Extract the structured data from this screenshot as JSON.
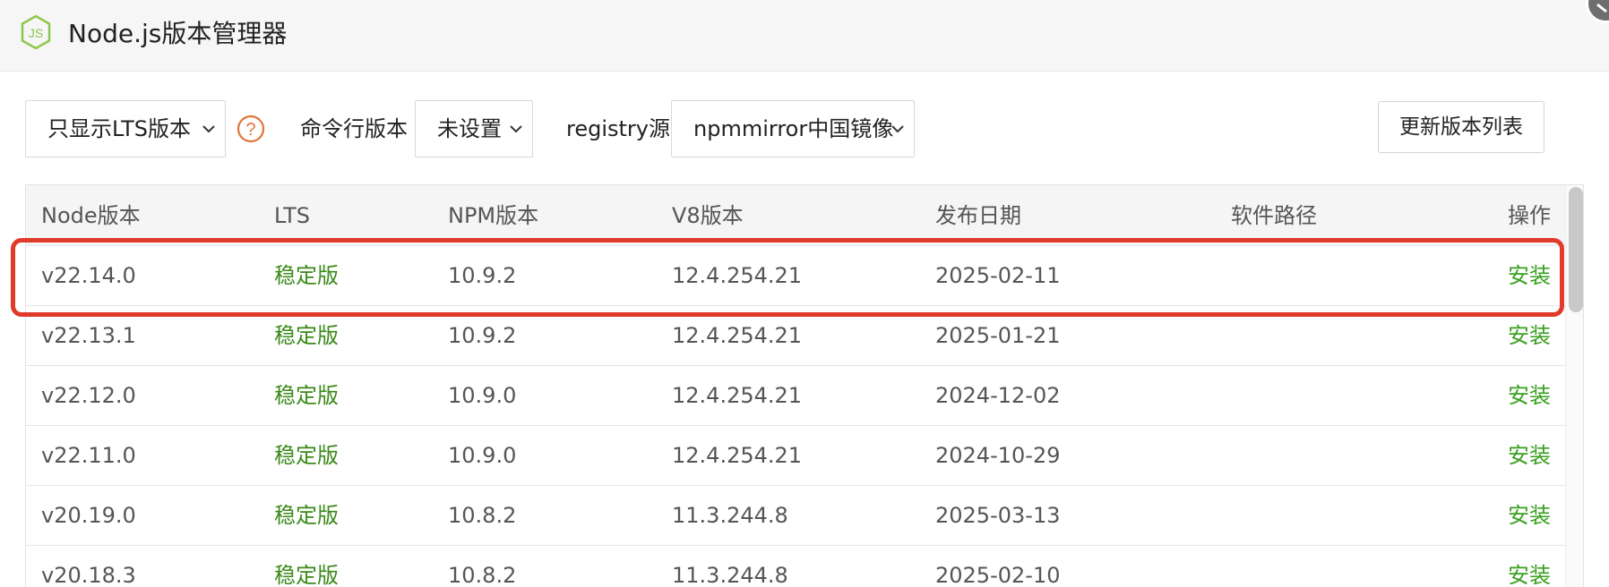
{
  "window": {
    "title": "Node.js版本管理器",
    "logo_icon": "nodejs-hexagon-icon",
    "close_icon": "close-icon"
  },
  "toolbar": {
    "filter_select": {
      "value": "只显示LTS版本"
    },
    "help_icon": "question-circle-icon",
    "cli_label": "命令行版本",
    "cli_select": {
      "value": "未设置"
    },
    "registry_label": "registry源",
    "registry_select": {
      "value": "npmmirror中国镜像"
    },
    "refresh_label": "更新版本列表"
  },
  "table": {
    "columns": [
      "Node版本",
      "LTS",
      "NPM版本",
      "V8版本",
      "发布日期",
      "软件路径",
      "操作"
    ],
    "rows": [
      {
        "node": "v22.14.0",
        "lts": "稳定版",
        "npm": "10.9.2",
        "v8": "12.4.254.21",
        "date": "2025-02-11",
        "path": "",
        "action": "安装"
      },
      {
        "node": "v22.13.1",
        "lts": "稳定版",
        "npm": "10.9.2",
        "v8": "12.4.254.21",
        "date": "2025-01-21",
        "path": "",
        "action": "安装"
      },
      {
        "node": "v22.12.0",
        "lts": "稳定版",
        "npm": "10.9.0",
        "v8": "12.4.254.21",
        "date": "2024-12-02",
        "path": "",
        "action": "安装"
      },
      {
        "node": "v22.11.0",
        "lts": "稳定版",
        "npm": "10.9.0",
        "v8": "12.4.254.21",
        "date": "2024-10-29",
        "path": "",
        "action": "安装"
      },
      {
        "node": "v20.19.0",
        "lts": "稳定版",
        "npm": "10.8.2",
        "v8": "11.3.244.8",
        "date": "2025-03-13",
        "path": "",
        "action": "安装"
      },
      {
        "node": "v20.18.3",
        "lts": "稳定版",
        "npm": "10.8.2",
        "v8": "11.3.244.8",
        "date": "2025-02-10",
        "path": "",
        "action": "安装"
      }
    ]
  },
  "colors": {
    "accent_green": "#3aa020",
    "lts_green": "#3a8a1a",
    "highlight_red": "#e03a2a",
    "help_orange": "#e0763a",
    "logo_green": "#8cc84b"
  }
}
